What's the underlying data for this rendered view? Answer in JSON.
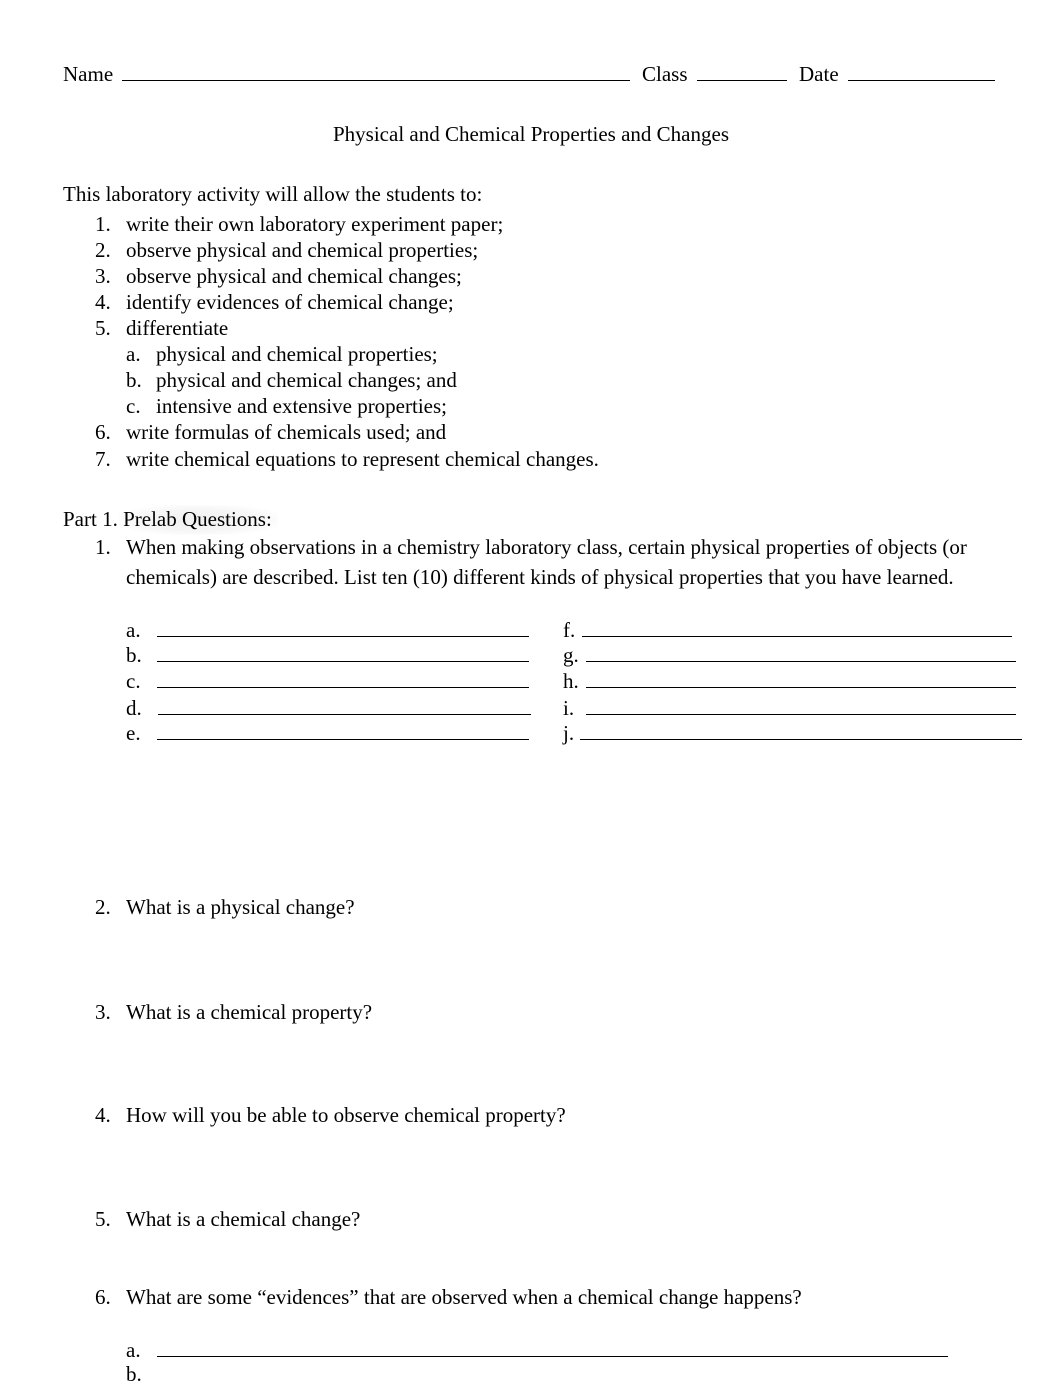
{
  "header": {
    "name_label": "Name",
    "class_label": "Class",
    "date_label": "Date"
  },
  "title": "Physical and Chemical Properties and Changes",
  "intro": {
    "text": "This laboratory activity will allow the students to:",
    "objectives": [
      {
        "num": "1.",
        "text": "write their own laboratory experiment paper;"
      },
      {
        "num": "2.",
        "text": "observe physical and chemical properties;"
      },
      {
        "num": "3.",
        "text": "observe physical and chemical changes;"
      },
      {
        "num": "4.",
        "text": "identify evidences of chemical change;"
      },
      {
        "num": "5.",
        "text": "differentiate"
      },
      {
        "num": "6.",
        "text": "write formulas of chemicals used; and"
      },
      {
        "num": "7.",
        "text": "write chemical equations to represent chemical changes."
      }
    ],
    "sub_objectives": [
      {
        "letter": "a.",
        "text": "physical and chemical properties;"
      },
      {
        "letter": "b.",
        "text": "physical and chemical changes; and"
      },
      {
        "letter": "c.",
        "text": "intensive and extensive properties;"
      }
    ]
  },
  "part1": {
    "heading_prefix": "Part 1.",
    "heading_highlight": "Prelab Questions:",
    "questions": [
      {
        "num": "1.",
        "line1": "When making observations in a chemistry laboratory class, certain physical properties of objects (or",
        "line2": "chemicals) are described. List ten (10) different kinds of physical properties that you have learned."
      },
      {
        "num": "2.",
        "text": "What is a physical change?"
      },
      {
        "num": "3.",
        "text": "What is a chemical property?"
      },
      {
        "num": "4.",
        "text": "How will you be able to observe chemical property?"
      },
      {
        "num": "5.",
        "text": "What is a chemical change?"
      },
      {
        "num": "6.",
        "text": "What are some “evidences” that are observed when a chemical change happens?"
      }
    ],
    "q1_answers_left": [
      "a.",
      "b.",
      "c.",
      "d.",
      "e."
    ],
    "q1_answers_right": [
      "f.",
      "g.",
      "h.",
      "i.",
      "j."
    ],
    "q6_answers": [
      "a.",
      "b."
    ]
  }
}
